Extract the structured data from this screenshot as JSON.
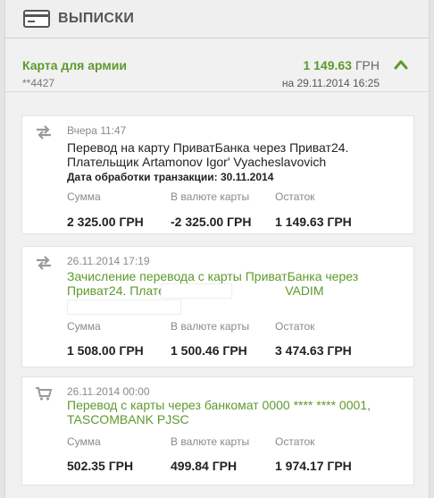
{
  "header": {
    "title": "ВЫПИСКИ",
    "icon": "card-icon"
  },
  "account": {
    "name": "Карта для армии",
    "number": "**4427",
    "balance": "1 149.63",
    "currency": "ГРН",
    "date": "на 29.11.2014 16:25"
  },
  "columns": {
    "sum": "Сумма",
    "card_currency": "В валюте карты",
    "rest": "Остаток"
  },
  "transactions": [
    {
      "icon": "transfer-icon",
      "time": "Вчера 11:47",
      "desc_line1": "Перевод на карту ПриватБанка через Приват24.",
      "desc_line2": "Плательщик Artamonov Igor' Vyacheslavovich",
      "processing": "Дата обработки транзакции: 30.11.2014",
      "sum": "2 325.00 ГРН",
      "card_amount": "-2 325.00 ГРН",
      "rest": "1 149.63 ГРН"
    },
    {
      "icon": "transfer-icon",
      "time": "26.11.2014 17:19",
      "desc_line1": "Зачисление перевода с карты ПриватБанка через",
      "desc_line2_a": "Приват24. Плательщик",
      "desc_line2_b": "VADIM",
      "sum": "1 508.00 ГРН",
      "card_amount": "1 500.46 ГРН",
      "rest": "3 474.63 ГРН"
    },
    {
      "icon": "cart-icon",
      "time": "26.11.2014 00:00",
      "desc_line1": "Перевод с карты через банкомат 0000 **** **** 0001,",
      "desc_line2": "TASCOMBANK PJSC",
      "sum": "502.35 ГРН",
      "card_amount": "499.84 ГРН",
      "rest": "1 974.17 ГРН"
    }
  ],
  "colors": {
    "accent": "#5d9a2d",
    "muted": "#8a8a8a",
    "background": "#f1f1f1"
  }
}
